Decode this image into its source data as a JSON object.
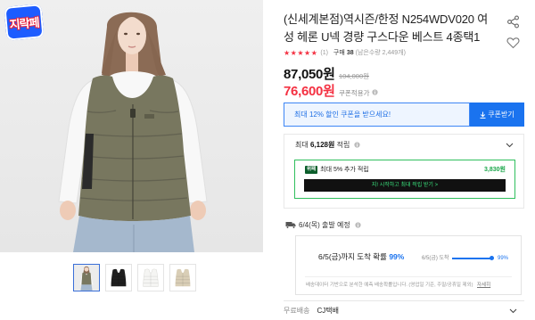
{
  "colors": {
    "accent": "#1a73ef",
    "price_red": "#f43142",
    "pay_green": "#2fbf5d",
    "pay_cta_green": "#39e07b",
    "star_red": "#f43142",
    "probability_blue": "#1a73ef"
  },
  "badge": {
    "text": "지락페"
  },
  "gallery": {
    "main_vest_color": "#78775f",
    "thumbnails": [
      {
        "vest_color": "#78775f",
        "selected": true
      },
      {
        "vest_color": "#1f1f1f",
        "selected": false
      },
      {
        "vest_color": "#f5f5f3",
        "selected": false
      },
      {
        "vest_color": "#d9ceb6",
        "selected": false
      }
    ]
  },
  "product": {
    "title": "(신세계본점)역시즌/한정 N254WDV020 여성 헤론 U넥 경량 구스다운 베스트 4종택1",
    "rating": {
      "value": 5,
      "max": 5,
      "count": "(1)"
    },
    "purchase": {
      "label": "구매",
      "count": "38",
      "stock": "(남은수량 2,449개)"
    },
    "price": "87,050원",
    "original_price": "104,000원",
    "coupon_price": "76,600원",
    "coupon_price_label": "쿠폰적용가"
  },
  "coupon": {
    "message": "최대 12% 할인 쿠폰을 받으세요!",
    "button": "쿠폰받기"
  },
  "points": {
    "prefix": "최대",
    "amount": "6,128원",
    "suffix": "적립",
    "pay": {
      "logo": "위패",
      "text": "최대 5% 추가 적립",
      "amount": "3,830원",
      "cta": "지! 시작하고 최대 적립 받기 >"
    }
  },
  "shipping": {
    "departure": "6/4(목) 출발 예정",
    "arrival_text": "6/5(금)까지 도착 확률",
    "arrival_probability": "99%",
    "bar_label": "6/5(금) 도착",
    "bar_value": "99%",
    "probability": 0.99,
    "note": "배송데이터 기반으로 분석한 예측 배송확률입니다. (영업일 기준, 주말/공휴일 제외)",
    "note_link": "자세히",
    "fee": "무료배송",
    "carrier": "CJ택배"
  }
}
